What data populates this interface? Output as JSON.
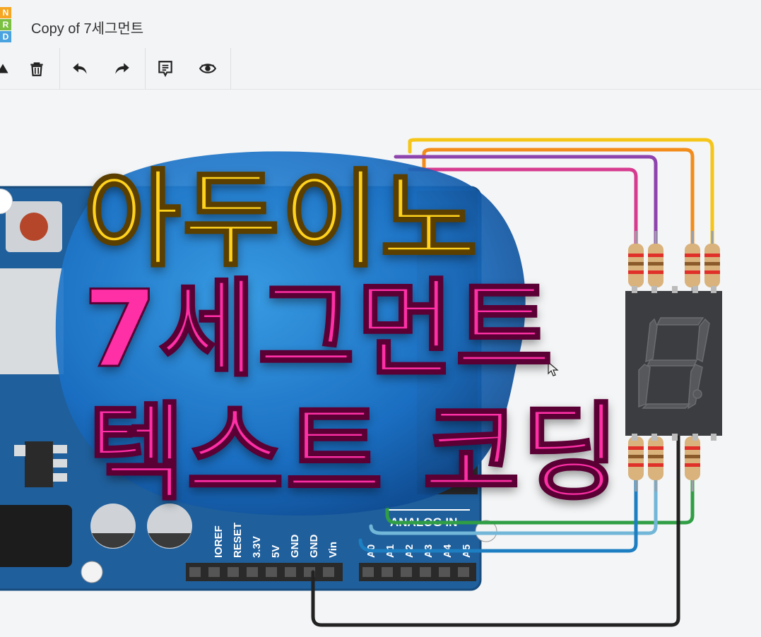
{
  "app": {
    "logo_letters": [
      "N",
      "R",
      "D"
    ],
    "logo_colors": [
      "#f5a623",
      "#7bc043",
      "#4aa3df"
    ],
    "document_title": "Copy of 7세그먼트"
  },
  "toolbar": {
    "items": [
      {
        "name": "delete-button",
        "icon": "trash-icon"
      },
      {
        "name": "undo-button",
        "icon": "undo-icon"
      },
      {
        "name": "redo-button",
        "icon": "redo-icon"
      },
      {
        "name": "notes-button",
        "icon": "notes-icon"
      },
      {
        "name": "visibility-button",
        "icon": "eye-icon"
      }
    ]
  },
  "overlay": {
    "line1": "아두이노",
    "line2": "7세그먼트",
    "line3": "텍스트 코딩",
    "colors": {
      "line1": "#ffd21e",
      "line2": "#ff2fa6",
      "line3": "#ff2fa6",
      "blob": "#1a6fc4"
    }
  },
  "board": {
    "color": "#1f5f9c",
    "power_pins": [
      "IOREF",
      "RESET",
      "3.3V",
      "5V",
      "GND",
      "GND",
      "Vin"
    ],
    "analog_header": "ANALOG IN",
    "analog_pins": [
      "A0",
      "A1",
      "A2",
      "A3",
      "A4",
      "A5"
    ]
  },
  "wires": {
    "colors": [
      "#f5c518",
      "#f28c1b",
      "#8e44ad",
      "#d63b8f",
      "#2f9e44",
      "#72b6d8",
      "#1d7fc1",
      "#222222"
    ]
  }
}
